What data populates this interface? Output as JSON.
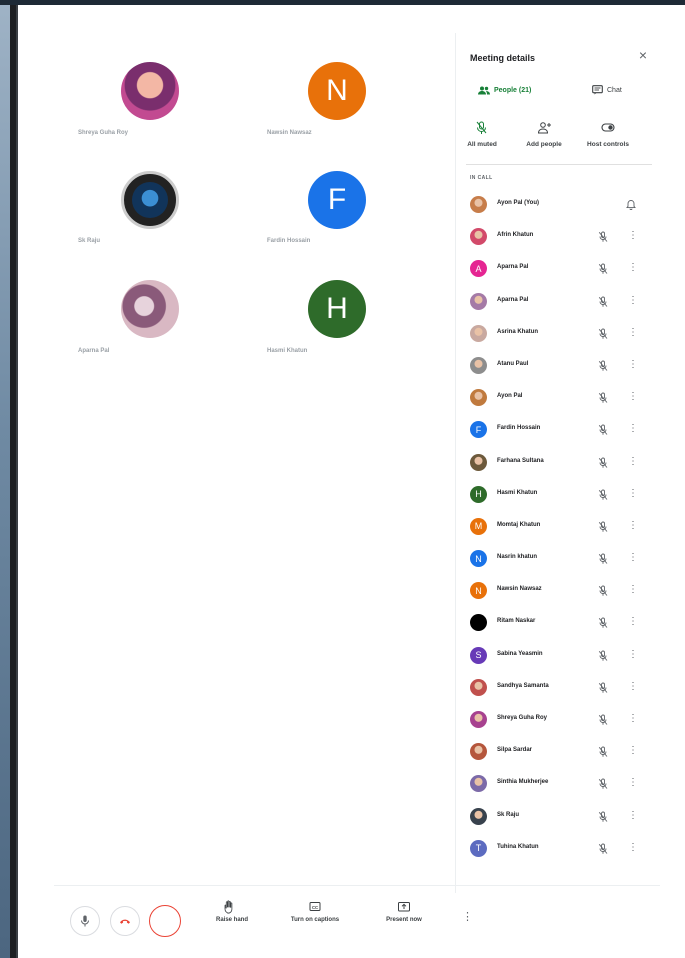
{
  "tiles": [
    {
      "name": "Shreya Guha Roy",
      "type": "photo",
      "photo": "shreya"
    },
    {
      "name": "Nawsin Nawsaz",
      "type": "initial",
      "initial": "N",
      "color": "#e8710a"
    },
    {
      "name": "Sk Raju",
      "type": "photo",
      "photo": "sk"
    },
    {
      "name": "Fardin Hossain",
      "type": "initial",
      "initial": "F",
      "color": "#1a73e8"
    },
    {
      "name": "Aparna Pal",
      "type": "photo",
      "photo": "aparna"
    },
    {
      "name": "Hasmi Khatun",
      "type": "initial",
      "initial": "H",
      "color": "#2e6b2a"
    }
  ],
  "panel": {
    "title": "Meeting details",
    "tabs": {
      "people": "People (21)",
      "chat": "Chat"
    },
    "controls": {
      "all_muted": "All muted",
      "add_people": "Add people",
      "host_controls": "Host controls"
    },
    "section_label": "IN CALL",
    "participants": [
      {
        "name": "Ayon Pal (You)",
        "avatar": "photo",
        "color": "#c77d4a",
        "self": true
      },
      {
        "name": "Afrin Khatun",
        "avatar": "photo",
        "color": "#d24a6a"
      },
      {
        "name": "Aparna Pal",
        "avatar": "initial",
        "initial": "A",
        "color": "#e52592"
      },
      {
        "name": "Aparna Pal",
        "avatar": "photo",
        "color": "#a57aa6"
      },
      {
        "name": "Asrina Khatun",
        "avatar": "photo",
        "color": "#c9a9a0"
      },
      {
        "name": "Atanu Paul",
        "avatar": "photo",
        "color": "#8d8d8d"
      },
      {
        "name": "Ayon Pal",
        "avatar": "photo",
        "color": "#c07a3e"
      },
      {
        "name": "Fardin Hossain",
        "avatar": "initial",
        "initial": "F",
        "color": "#1a73e8"
      },
      {
        "name": "Farhana Sultana",
        "avatar": "photo",
        "color": "#6d5a3c"
      },
      {
        "name": "Hasmi Khatun",
        "avatar": "initial",
        "initial": "H",
        "color": "#2e6b2a"
      },
      {
        "name": "Momtaj Khatun",
        "avatar": "initial",
        "initial": "M",
        "color": "#e8710a"
      },
      {
        "name": "Nasrin khatun",
        "avatar": "initial",
        "initial": "N",
        "color": "#1a73e8"
      },
      {
        "name": "Nawsin Nawsaz",
        "avatar": "initial",
        "initial": "N",
        "color": "#e8710a"
      },
      {
        "name": "Ritam Naskar",
        "avatar": "photo",
        "color": "#000000"
      },
      {
        "name": "Sabina Yeasmin",
        "avatar": "initial",
        "initial": "S",
        "color": "#673ab7"
      },
      {
        "name": "Sandhya Samanta",
        "avatar": "photo",
        "color": "#c0504d"
      },
      {
        "name": "Shreya Guha Roy",
        "avatar": "photo",
        "color": "#a7428f"
      },
      {
        "name": "Silpa Sardar",
        "avatar": "photo",
        "color": "#b5563c"
      },
      {
        "name": "Sinthia Mukherjee",
        "avatar": "photo",
        "color": "#7c6aa8"
      },
      {
        "name": "Sk Raju",
        "avatar": "photo",
        "color": "#38424d"
      },
      {
        "name": "Tuhina Khatun",
        "avatar": "initial",
        "initial": "T",
        "color": "#5c6bc0"
      }
    ]
  },
  "bottombar": {
    "raise_hand": "Raise hand",
    "captions": "Turn on captions",
    "present": "Present now"
  },
  "colors": {
    "accent_green": "#188038",
    "end_call_red": "#ea4335"
  }
}
